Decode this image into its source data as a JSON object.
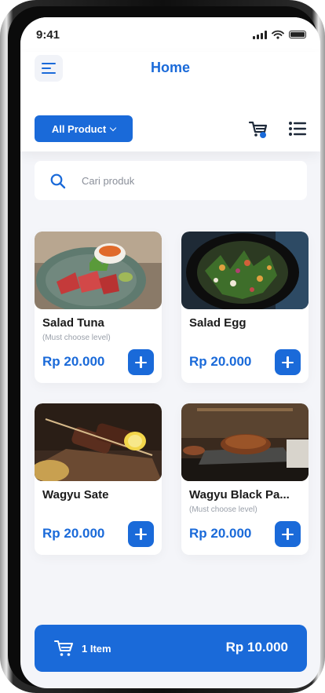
{
  "status": {
    "time": "9:41"
  },
  "header": {
    "title": "Home",
    "filter_label": "All Product"
  },
  "search": {
    "placeholder": "Cari produk"
  },
  "products": [
    {
      "name": "Salad Tuna",
      "note": "(Must choose level)",
      "price": "Rp 20.000"
    },
    {
      "name": "Salad Egg",
      "note": "",
      "price": "Rp 20.000"
    },
    {
      "name": "Wagyu Sate",
      "note": "",
      "price": "Rp 20.000"
    },
    {
      "name": "Wagyu Black Pa...",
      "note": "(Must choose level)",
      "price": "Rp 20.000"
    }
  ],
  "cart": {
    "count_label": "1 Item",
    "total": "Rp 10.000"
  },
  "colors": {
    "accent": "#1a6ad9",
    "background": "#f4f5f9",
    "card": "#ffffff"
  },
  "icons": [
    "menu-icon",
    "cart-icon",
    "list-view-icon",
    "search-icon",
    "plus-icon"
  ]
}
